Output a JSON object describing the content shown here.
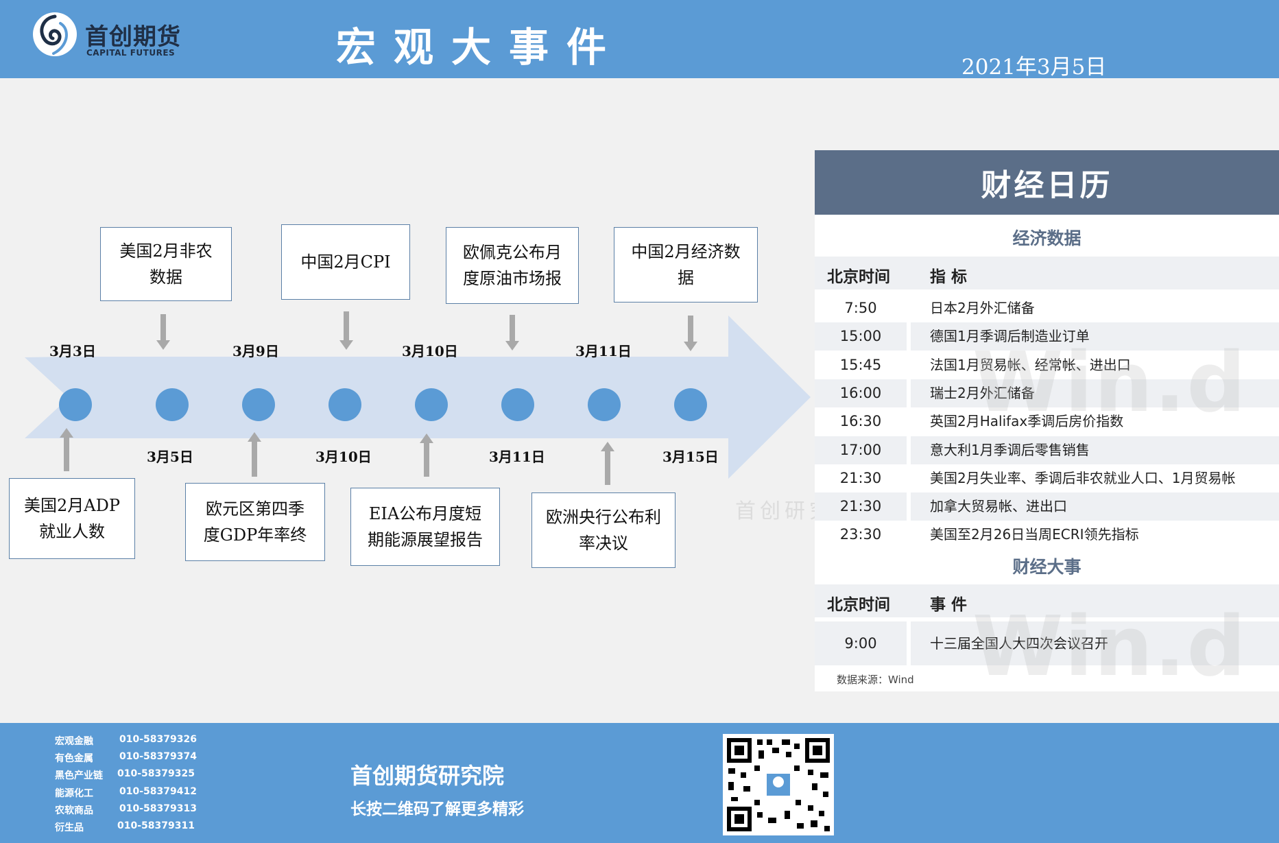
{
  "header": {
    "logo_cn": "首创期货",
    "logo_en": "CAPITAL FUTURES",
    "title": "宏观大事件",
    "date": "2021年3月5日"
  },
  "timeline": {
    "top_dates": [
      "3月3日",
      "3月9日",
      "3月10日",
      "3月11日"
    ],
    "bottom_dates": [
      "3月5日",
      "3月10日",
      "3月11日",
      "3月15日"
    ],
    "top_events": [
      [
        "美国2月非农",
        "数据"
      ],
      [
        "中国2月CPI"
      ],
      [
        "欧佩克公布月",
        "度原油市场报"
      ],
      [
        "中国2月经济数",
        "据"
      ]
    ],
    "bottom_events": [
      [
        "美国2月ADP",
        "就业人数"
      ],
      [
        "欧元区第四季",
        "度GDP年率终"
      ],
      [
        "EIA公布月度短",
        "期能源展望报告"
      ],
      [
        "欧洲央行公布利",
        "率决议"
      ]
    ],
    "watermark": "首创研究"
  },
  "calendar": {
    "title": "财经日历",
    "econ_section": "经济数据",
    "col_time": "北京时间",
    "col_indicator": "指  标",
    "econ_rows": [
      {
        "time": "7:50",
        "item": "日本2月外汇储备"
      },
      {
        "time": "15:00",
        "item": "德国1月季调后制造业订单"
      },
      {
        "time": "15:45",
        "item": "法国1月贸易帐、经常帐、进出口"
      },
      {
        "time": "16:00",
        "item": "瑞士2月外汇储备"
      },
      {
        "time": "16:30",
        "item": "英国2月Halifax季调后房价指数"
      },
      {
        "time": "17:00",
        "item": "意大利1月季调后零售销售"
      },
      {
        "time": "21:30",
        "item": "美国2月失业率、季调后非农就业人口、1月贸易帐"
      },
      {
        "time": "21:30",
        "item": "加拿大贸易帐、进出口"
      },
      {
        "time": "23:30",
        "item": "美国至2月26日当周ECRI领先指标"
      }
    ],
    "events_section": "财经大事",
    "col_event": "事  件",
    "event_rows": [
      {
        "time": "9:00",
        "item": "十三届全国人大四次会议召开"
      }
    ],
    "source": "数据来源：Wind",
    "watermark": "Win.d"
  },
  "footer": {
    "contacts": [
      {
        "dept": "宏观金融",
        "phone": "010-58379326"
      },
      {
        "dept": "有色金属",
        "phone": "010-58379374"
      },
      {
        "dept": "黑色产业链",
        "phone": "010-58379325"
      },
      {
        "dept": "能源化工",
        "phone": "010-58379412"
      },
      {
        "dept": "农软商品",
        "phone": "010-58379313"
      },
      {
        "dept": "衍生品",
        "phone": "010-58379311"
      }
    ],
    "institute": "首创期货研究院",
    "slogan": "长按二维码了解更多精彩"
  },
  "colors": {
    "header_blue": "#5b9bd5",
    "calendar_slate": "#5b6e88",
    "arrow_light": "#d3dff0"
  }
}
